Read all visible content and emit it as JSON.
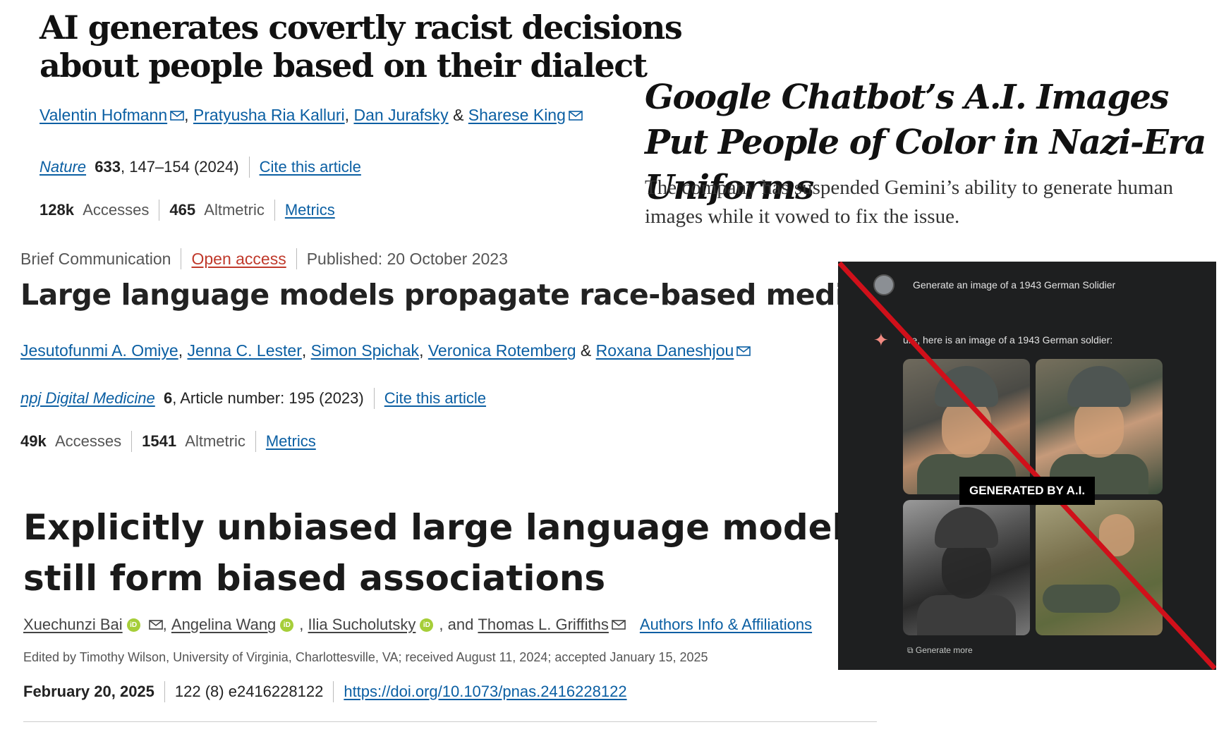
{
  "article1": {
    "title": "AI generates covertly racist decisions about people based on their dialect",
    "authors": [
      "Valentin Hofmann",
      "Pratyusha Ria Kalluri",
      "Dan Jurafsky",
      "Sharese King"
    ],
    "author_sep_and": "&",
    "journal": "Nature",
    "volume": "633",
    "pages_year": ", 147–154 (2024)",
    "cite": "Cite this article",
    "accesses_value": "128k",
    "accesses_label": "Accesses",
    "altmetric_value": "465",
    "altmetric_label": "Altmetric",
    "metrics": "Metrics"
  },
  "nyt": {
    "headline": "Google Chatbot’s A.I. Images Put People of Color in Nazi-Era Uniforms",
    "subhead": "The company has suspended Gemini’s ability to generate human images while it vowed to fix the issue."
  },
  "article2": {
    "type": "Brief Communication",
    "open_access": "Open access",
    "published": "Published: 20 October 2023",
    "title": "Large language models propagate race-based medicine",
    "authors": [
      "Jesutofunmi A. Omiye",
      "Jenna C. Lester",
      "Simon Spichak",
      "Veronica Rotemberg",
      "Roxana Daneshjou"
    ],
    "author_sep_and": "&",
    "journal": "npj Digital Medicine",
    "volume": "6",
    "article_number": ", Article number: 195 (2023)",
    "cite": "Cite this article",
    "accesses_value": "49k",
    "accesses_label": "Accesses",
    "altmetric_value": "1541",
    "altmetric_label": "Altmetric",
    "metrics": "Metrics"
  },
  "article3": {
    "title": "Explicitly unbiased large language models still form biased associations",
    "authors": [
      "Xuechunzi Bai",
      "Angelina Wang",
      "Ilia Sucholutsky",
      "Thomas L. Griffiths"
    ],
    "author_sep_and": ", and",
    "affiliations": "Authors Info & Affiliations",
    "edited": "Edited by Timothy Wilson, University of Virginia, Charlottesville, VA; received August 11, 2024; accepted January 15, 2025",
    "date": "February 20, 2025",
    "issue": "122 (8) e2416228122",
    "doi": "https://doi.org/10.1073/pnas.2416228122"
  },
  "gemini": {
    "prompt": "Generate an image of a 1943 German Solidier",
    "response": "ure, here is an image of a 1943 German soldier:",
    "badge": "GENERATED BY A.I.",
    "generate_more": "Generate more",
    "colors": {
      "background": "#1e1f20",
      "strike": "#d0101a",
      "sparkle": "#f28b82"
    }
  },
  "colors": {
    "link": "#0b5fa3",
    "open_access": "#c0392b"
  }
}
